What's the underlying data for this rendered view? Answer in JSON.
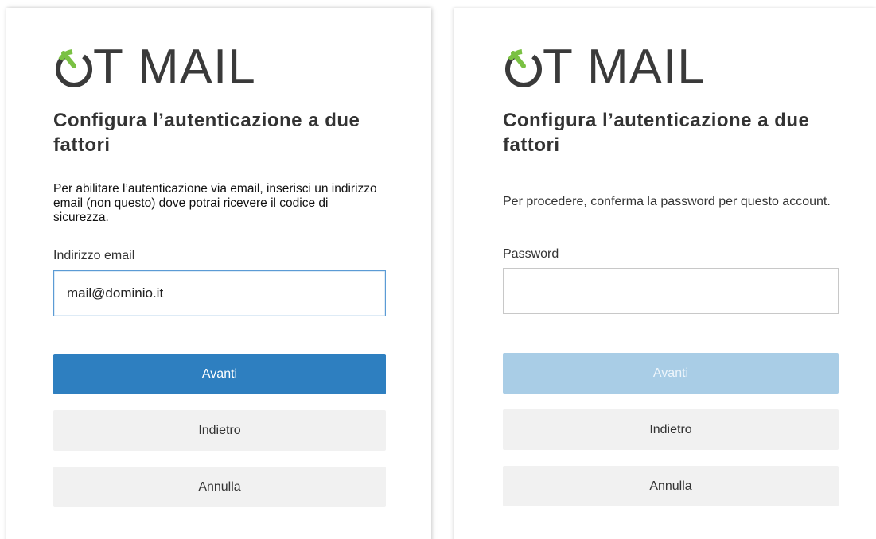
{
  "panels": [
    {
      "logo_text": "T MAIL",
      "title": "Configura l’autenticazione a due fattori",
      "description": "Per abilitare l’autenticazione via email, inserisci un indirizzo email (non questo) dove potrai ricevere il codice di sicurezza.",
      "field_label": "Indirizzo email",
      "field_value": "mail@dominio.it",
      "next_label": "Avanti",
      "back_label": "Indietro",
      "cancel_label": "Annulla"
    },
    {
      "logo_text": "T MAIL",
      "title": "Configura l’autenticazione a due fattori",
      "description": "Per procedere, conferma la password per questo account.",
      "field_label": "Password",
      "field_value": "",
      "next_label": "Avanti",
      "back_label": "Indietro",
      "cancel_label": "Annulla"
    }
  ],
  "colors": {
    "primary": "#2e7fc0",
    "primary_disabled": "#a9cde6",
    "secondary": "#f1f1f1",
    "logo_accent": "#7ac143",
    "logo_text": "#3a3a3a"
  },
  "icons": {
    "logo_mark": "power-o-icon"
  }
}
